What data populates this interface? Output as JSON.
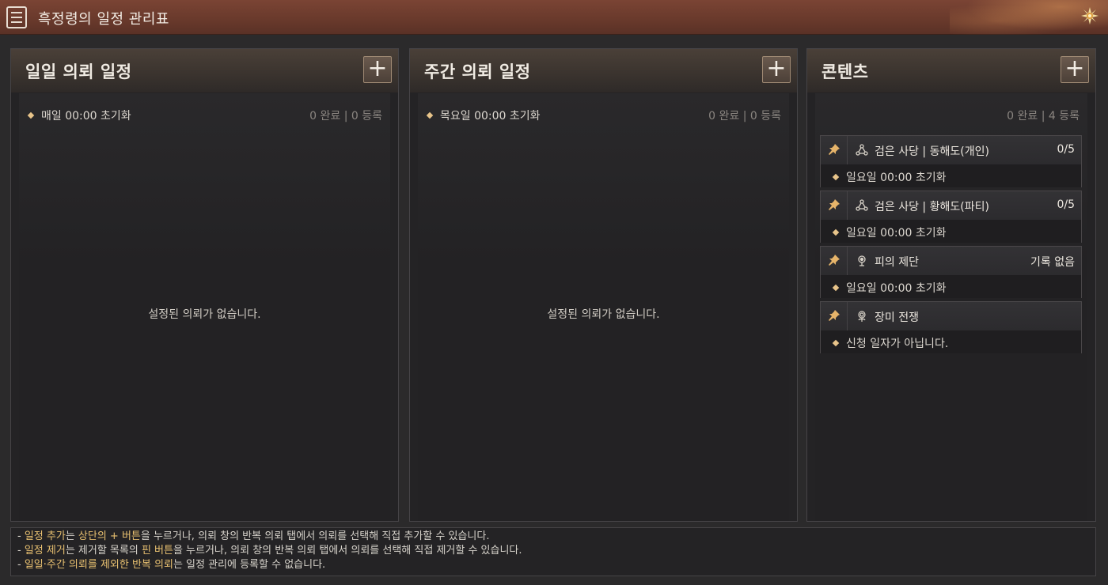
{
  "window": {
    "title": "흑정령의 일정 관리표",
    "title_icon": "checklist-icon",
    "close_icon": "sun-close-icon"
  },
  "panels": [
    {
      "title": "일일 의뢰 일정",
      "add_label": "+",
      "reset_text": "매일 00:00 초기화",
      "count_text": "0 완료 | 0 등록",
      "empty_text": "설정된 의뢰가 없습니다."
    },
    {
      "title": "주간 의뢰 일정",
      "add_label": "+",
      "reset_text": "목요일 00:00 초기화",
      "count_text": "0 완료 | 0 등록",
      "empty_text": "설정된 의뢰가 없습니다."
    },
    {
      "title": "콘텐츠",
      "add_label": "+",
      "count_text": "0 완료 | 4 등록",
      "items": [
        {
          "name": "검은 사당 | 동해도(개인)",
          "status": "0/5",
          "reset": "일요일 00:00 초기화",
          "icon": "triad-icon"
        },
        {
          "name": "검은 사당 | 황해도(파티)",
          "status": "0/5",
          "reset": "일요일 00:00 초기화",
          "icon": "triad-icon"
        },
        {
          "name": "피의 제단",
          "status": "기록 없음",
          "reset": "일요일 00:00 초기화",
          "icon": "altar-icon"
        },
        {
          "name": "장미 전쟁",
          "status": "",
          "reset": "신청 일자가 아닙니다.",
          "icon": "rose-icon"
        }
      ]
    }
  ],
  "help": {
    "line1": {
      "p1": "일정 추가",
      "p2": "는 ",
      "p3": "상단의 + 버튼",
      "p4": "을 누르거나, 의뢰 창의 반복 의뢰 탭에서 의뢰를 선택해 직접 추가할 수 있습니다."
    },
    "line2": {
      "p1": "일정 제거",
      "p2": "는 제거할 목록의 ",
      "p3": "핀 버튼",
      "p4": "을 누르거나, 의뢰 창의 반복 의뢰 탭에서 의뢰를 선택해 직접 제거할 수 있습니다."
    },
    "line3": {
      "p1": "일일·주간 의뢰를 제외한 반복 의뢰",
      "p2": "는 일정 관리에 등록할 수 없습니다."
    }
  },
  "colors": {
    "accent": "#e8c070",
    "titlebar": "#6a3a2c",
    "panel_bg": "#242325"
  }
}
